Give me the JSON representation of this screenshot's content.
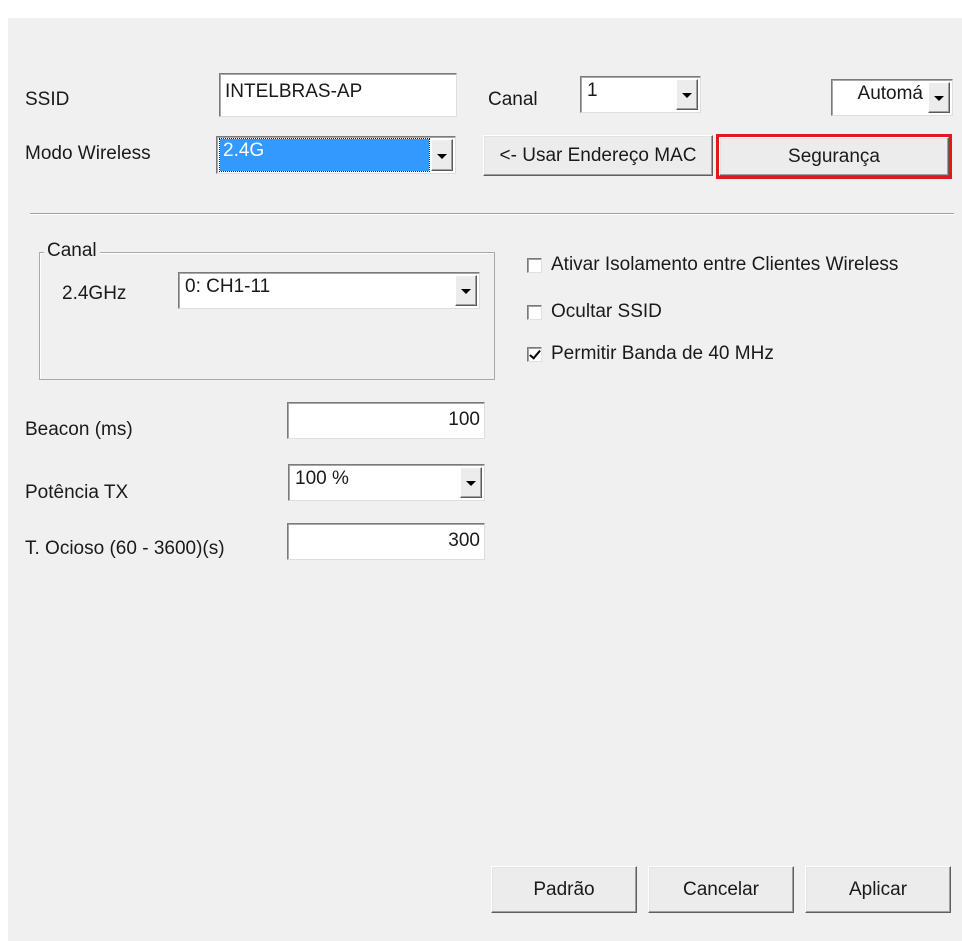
{
  "general": {
    "ssid_label": "SSID",
    "ssid_value": "INTELBRAS-AP",
    "channel_label": "Canal",
    "channel_value": "1",
    "auto_value": "Automá",
    "wireless_mode_label": "Modo Wireless",
    "wireless_mode_value": "2.4G",
    "use_mac_button": "<- Usar Endereço MAC",
    "security_button": "Segurança"
  },
  "channel_group": {
    "title": "Canal",
    "band_label": "2.4GHz",
    "band_value": "0: CH1-11"
  },
  "options": [
    {
      "label": "Ativar Isolamento entre Clientes Wireless",
      "checked": false
    },
    {
      "label": "Ocultar SSID",
      "checked": false
    },
    {
      "label": "Permitir Banda de 40 MHz",
      "checked": true
    }
  ],
  "advanced": {
    "beacon_label": "Beacon (ms)",
    "beacon_value": "100",
    "tx_power_label": "Potência TX",
    "tx_power_value": "100 %",
    "idle_timeout_label": "T. Ocioso (60 - 3600)(s)",
    "idle_timeout_value": "300"
  },
  "footer": {
    "default_button": "Padrão",
    "cancel_button": "Cancelar",
    "apply_button": "Aplicar"
  },
  "colors": {
    "window_bg": "#f0f0f0",
    "selection": "#3399ff",
    "highlight_outline": "#e0191f"
  }
}
